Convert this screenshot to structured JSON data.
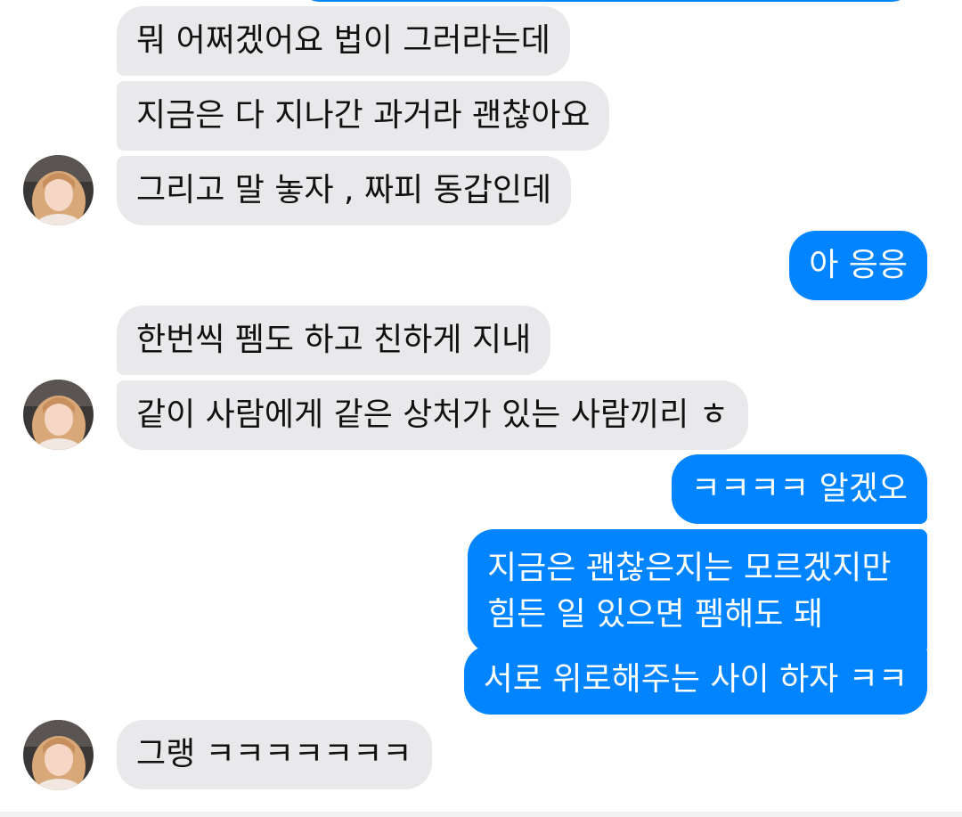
{
  "messages": [
    {
      "side": "in",
      "text": "뭐 어쩌겠어요 법이 그러라는데"
    },
    {
      "side": "in",
      "text": "지금은 다 지나간 과거라 괜찮아요"
    },
    {
      "side": "in",
      "text": "그리고 말 놓자 , 짜피 동갑인데"
    },
    {
      "side": "out",
      "text": "아 응응"
    },
    {
      "side": "in",
      "text": "한번씩 펨도 하고 친하게 지내"
    },
    {
      "side": "in",
      "text": "같이 사람에게 같은 상처가 있는 사람끼리 ㅎ"
    },
    {
      "side": "out",
      "text": "ㅋㅋㅋㅋ 알겠오"
    },
    {
      "side": "out",
      "lines": [
        "지금은 괜찮은지는 모르겠지만",
        "힘든 일 있으면 펨해도 돼"
      ]
    },
    {
      "side": "out",
      "text": "서로 위로해주는 사이 하자 ㅋㅋ"
    },
    {
      "side": "in",
      "text": "그랭 ㅋㅋㅋㅋㅋㅋㅋ"
    }
  ],
  "avatars": [
    {
      "icon": "contact-avatar"
    },
    {
      "icon": "contact-avatar"
    },
    {
      "icon": "contact-avatar"
    }
  ],
  "colors": {
    "incoming_bubble": "#e9e9eb",
    "outgoing_bubble": "#0084ff",
    "incoming_text": "#111111",
    "outgoing_text": "#ffffff"
  }
}
